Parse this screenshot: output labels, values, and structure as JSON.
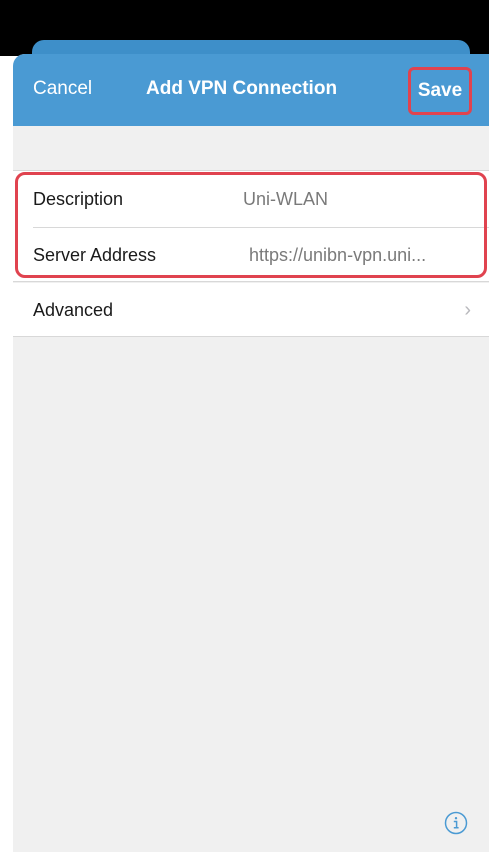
{
  "navbar": {
    "cancel_label": "Cancel",
    "title": "Add VPN Connection",
    "save_label": "Save"
  },
  "form": {
    "description": {
      "label": "Description",
      "value": "Uni-WLAN"
    },
    "server_address": {
      "label": "Server Address",
      "value": "https://unibn-vpn.uni..."
    }
  },
  "advanced": {
    "label": "Advanced",
    "chevron_icon": "chevron-right-icon"
  },
  "footer": {
    "icon": "info-icon"
  },
  "colors": {
    "navbar_bg": "#4a9ad3",
    "highlight": "#e0434f",
    "background": "#f0f0f0"
  }
}
